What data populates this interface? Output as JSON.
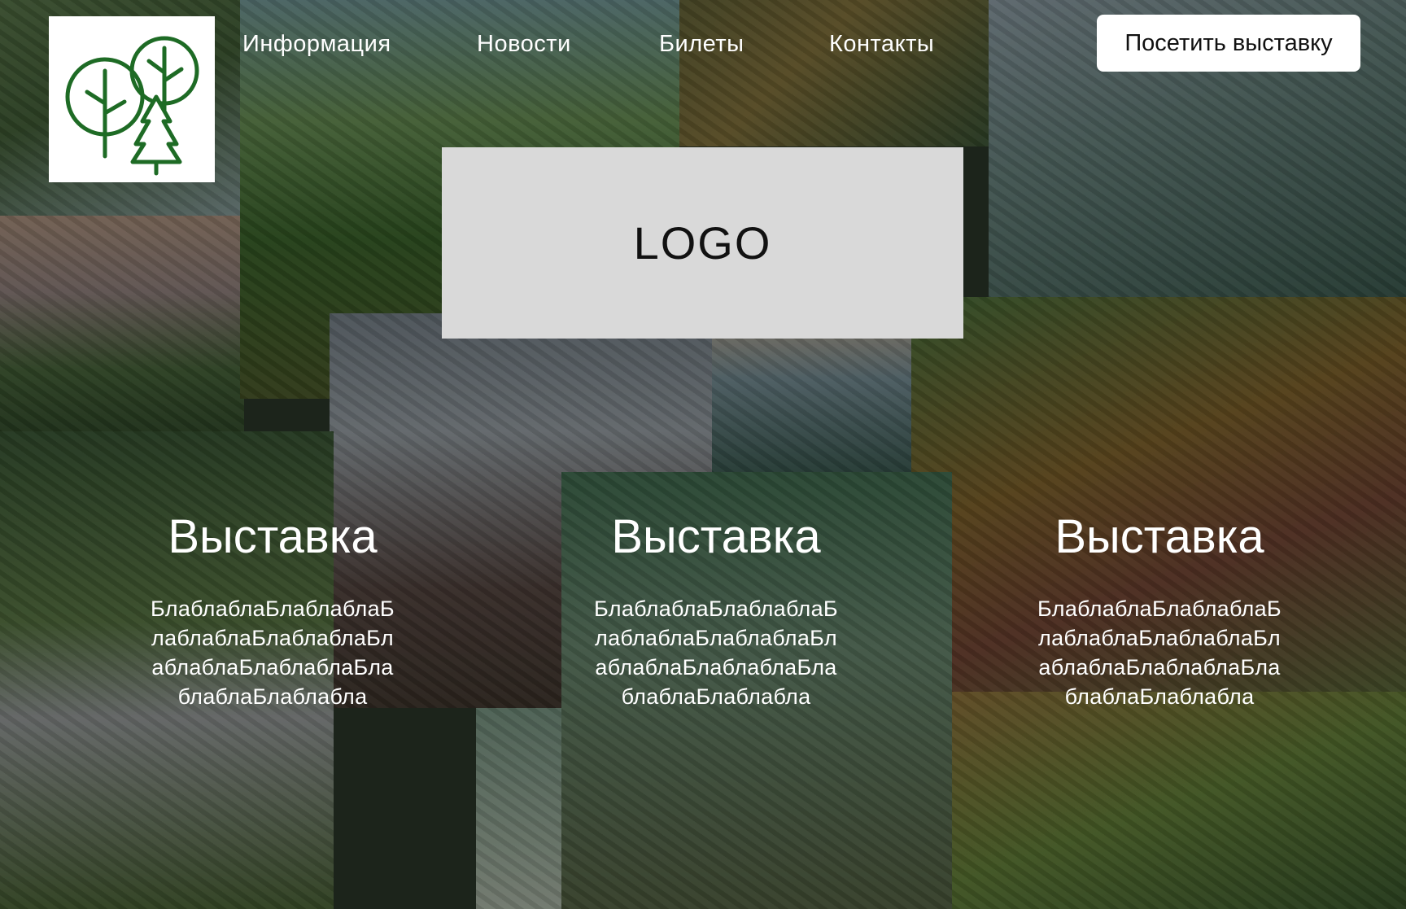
{
  "nav": {
    "items": [
      {
        "label": "Информация"
      },
      {
        "label": "Новости"
      },
      {
        "label": "Билеты"
      },
      {
        "label": "Контакты"
      }
    ],
    "cta_label": "Посетить выставку"
  },
  "brand": {
    "icon": "trees-icon",
    "icon_color": "#1e6b25"
  },
  "hero": {
    "logo_text": "LOGO"
  },
  "cards": [
    {
      "title": "Выставка",
      "text": "БлаблаблаБлаблаблаБлаблаблаБлаблаблаБлаблаблаБлаблаблаБлаблаблаБлаблабла"
    },
    {
      "title": "Выставка",
      "text": "БлаблаблаБлаблаблаБлаблаблаБлаблаблаБлаблаблаБлаблаблаБлаблаблаБлаблабла"
    },
    {
      "title": "Выставка",
      "text": "БлаблаблаБлаблаблаБлаблаблаБлаблаблаБлаблаблаБлаблаблаБлаблаблаБлаблабла"
    }
  ]
}
